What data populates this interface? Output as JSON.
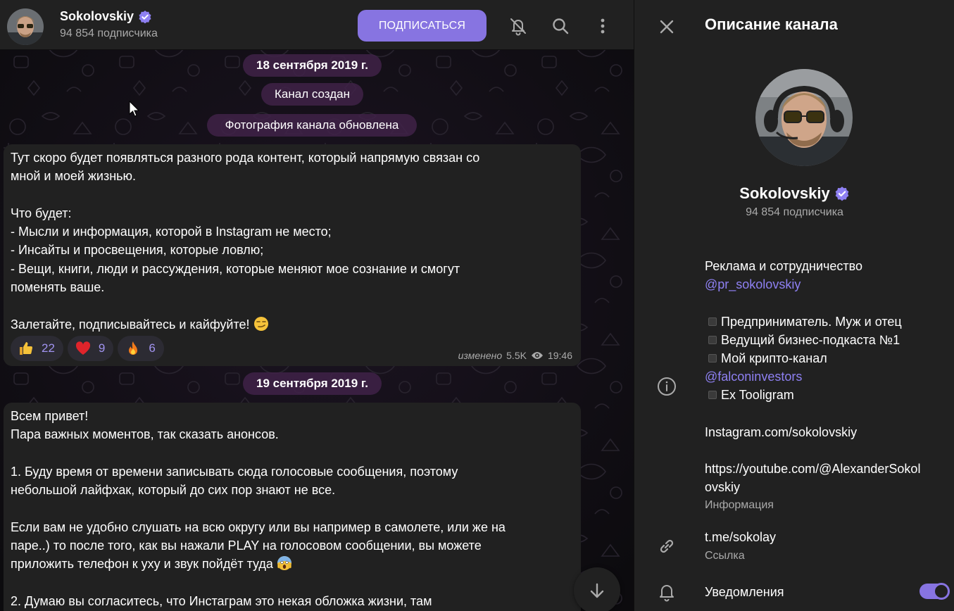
{
  "colors": {
    "accent": "#8774e1",
    "link": "#8e80f2",
    "panel": "#212121",
    "pill": "#402248"
  },
  "header": {
    "channel_name": "Sokolovskiy",
    "subscribers": "94 854 подписчика",
    "subscribe_label": "ПОДПИСАТЬСЯ",
    "icons": [
      "bell-off-icon",
      "search-icon",
      "more-vertical-icon"
    ]
  },
  "chat": {
    "date1": "18 сентября 2019 г.",
    "service1": "Канал создан",
    "service2": "Фотография канала обновлена",
    "message1": {
      "lines": [
        "Тут скоро будет появляться разного рода контент, который напрямую связан со",
        "мной и моей жизнью.",
        "",
        "Что будет:",
        "- Мысли и информация, которой в Instagram не место;",
        "- Инсайты и просвещения, которые ловлю;",
        "- Вещи, книги, люди и рассуждения, которые меняют мое сознание и смогут",
        "поменять ваше.",
        ""
      ],
      "last_line": "Залетайте, подписывайтесь и кайфуйте!",
      "reactions": [
        {
          "icon": "thumbs-up-icon",
          "count": "22"
        },
        {
          "icon": "heart-icon",
          "count": "9"
        },
        {
          "icon": "fire-icon",
          "count": "6"
        }
      ],
      "edited": "изменено",
      "views": "5.5K",
      "time": "19:46"
    },
    "date2": "19 сентября 2019 г.",
    "message2": {
      "lines": [
        "Всем привет!",
        "Пара важных моментов, так сказать анонсов.",
        "",
        "1. Буду время от времени записывать сюда голосовые сообщения, поэтому",
        "небольшой лайфхак, который до сих пор знают не все.",
        "",
        "Если вам не удобно слушать на всю округу или вы например в самолете, или же на",
        "паре..) то после того, как вы нажали PLAY на голосовом сообщении, вы можете"
      ],
      "line_with_emoji": "приложить телефон к уху и звук пойдёт туда",
      "after": [
        "",
        "2. Думаю вы согласитесь, что Инстаграм это некая обложка жизни, там"
      ]
    }
  },
  "info": {
    "title": "Описание канала",
    "name": "Sokolovskiy",
    "subscribers": "94 854 подписчика",
    "description": {
      "ads_label": "Реклама и сотрудничество",
      "ads_link": "@pr_sokolovskiy",
      "bullets": [
        "Предприниматель. Муж и отец",
        "Ведущий бизнес-подкаста №1",
        "Мой крипто-канал"
      ],
      "crypto_link": "@falconinvestors",
      "bullet4": "Ex Tooligram",
      "instagram": "Instagram.com/sokolovskiy",
      "youtube_line1": "https://youtube.com/@AlexanderSokol",
      "youtube_line2": "ovskiy",
      "caption": "Информация"
    },
    "link": {
      "value": "t.me/sokolay",
      "caption": "Ссылка"
    },
    "notifications": {
      "label": "Уведомления",
      "enabled": true
    }
  }
}
